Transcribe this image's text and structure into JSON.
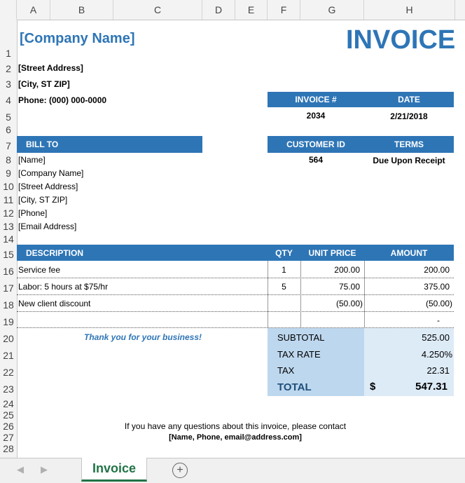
{
  "columns": [
    "A",
    "B",
    "C",
    "D",
    "E",
    "F",
    "G",
    "H"
  ],
  "rows": [
    "1",
    "2",
    "3",
    "4",
    "5",
    "6",
    "7",
    "8",
    "9",
    "10",
    "11",
    "12",
    "13",
    "14",
    "15",
    "16",
    "17",
    "18",
    "19",
    "20",
    "21",
    "22",
    "23",
    "24",
    "25",
    "26",
    "27",
    "28"
  ],
  "company": {
    "name": "[Company Name]",
    "street": "[Street Address]",
    "city": "[City, ST  ZIP]",
    "phone": "Phone: (000) 000-0000"
  },
  "invoice_title": "INVOICE",
  "meta": {
    "invoice_no_label": "INVOICE #",
    "date_label": "DATE",
    "invoice_no": "2034",
    "date": "2/21/2018",
    "customer_id_label": "CUSTOMER ID",
    "terms_label": "TERMS",
    "customer_id": "564",
    "terms": "Due Upon Receipt"
  },
  "bill_to": {
    "label": "BILL TO",
    "lines": [
      "[Name]",
      "[Company Name]",
      "[Street Address]",
      "[City, ST  ZIP]",
      "[Phone]",
      "[Email Address]"
    ]
  },
  "items": {
    "headers": {
      "description": "DESCRIPTION",
      "qty": "QTY",
      "unit_price": "UNIT PRICE",
      "amount": "AMOUNT"
    },
    "rows": [
      {
        "description": "Service fee",
        "qty": "1",
        "unit_price": "200.00",
        "amount": "200.00"
      },
      {
        "description": "Labor: 5 hours at $75/hr",
        "qty": "5",
        "unit_price": "75.00",
        "amount": "375.00"
      },
      {
        "description": "New client discount",
        "qty": "",
        "unit_price": "(50.00)",
        "amount": "(50.00)"
      },
      {
        "description": "",
        "qty": "",
        "unit_price": "",
        "amount": "-"
      }
    ]
  },
  "thanks": "Thank you for your business!",
  "totals": {
    "subtotal_label": "SUBTOTAL",
    "subtotal": "525.00",
    "tax_rate_label": "TAX RATE",
    "tax_rate": "4.250%",
    "tax_label": "TAX",
    "tax": "22.31",
    "total_label": "TOTAL",
    "currency": "$",
    "total": "547.31"
  },
  "footer": {
    "line1": "If you have any questions about this invoice, please contact",
    "line2": "[Name, Phone, email@address.com]"
  },
  "sheet_tab": "Invoice",
  "colors": {
    "accent": "#2e75b6",
    "light_blue": "#bdd7ee",
    "lighter_blue": "#ddebf7",
    "tab_green": "#217346"
  }
}
